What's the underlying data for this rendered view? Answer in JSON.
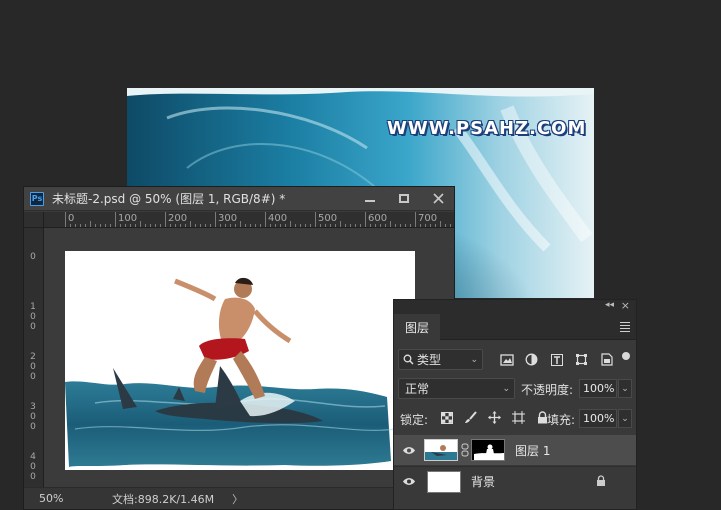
{
  "background_image": {
    "watermark": "WWW.PSAHZ.COM"
  },
  "document": {
    "title": "未标题-2.psd @ 50% (图层 1, RGB/8#) *",
    "ps_badge": "Ps",
    "ruler_h": [
      "0",
      "100",
      "200",
      "300",
      "400",
      "500",
      "600",
      "700"
    ],
    "ruler_v": [
      {
        "label": [
          "0"
        ]
      },
      {
        "label": [
          "1",
          "0",
          "0"
        ]
      },
      {
        "label": [
          "2",
          "0",
          "0"
        ]
      },
      {
        "label": [
          "3",
          "0",
          "0"
        ]
      },
      {
        "label": [
          "4",
          "0",
          "0"
        ]
      }
    ],
    "status": {
      "zoom": "50%",
      "info": "文档:898.2K/1.46M",
      "arrow": "〉"
    }
  },
  "layers_panel": {
    "tab_label": "图层",
    "filter_kind": "类型",
    "blend_mode": "正常",
    "opacity_label": "不透明度:",
    "opacity_value": "100%",
    "lock_label": "锁定:",
    "fill_label": "填充:",
    "fill_value": "100%",
    "layers": [
      {
        "name": "图层 1",
        "active": true
      },
      {
        "name": "背景",
        "active": false
      }
    ]
  },
  "colors": {
    "app_bg": "#282828",
    "panel_bg": "#393939",
    "active_row": "#4d4d4d"
  }
}
